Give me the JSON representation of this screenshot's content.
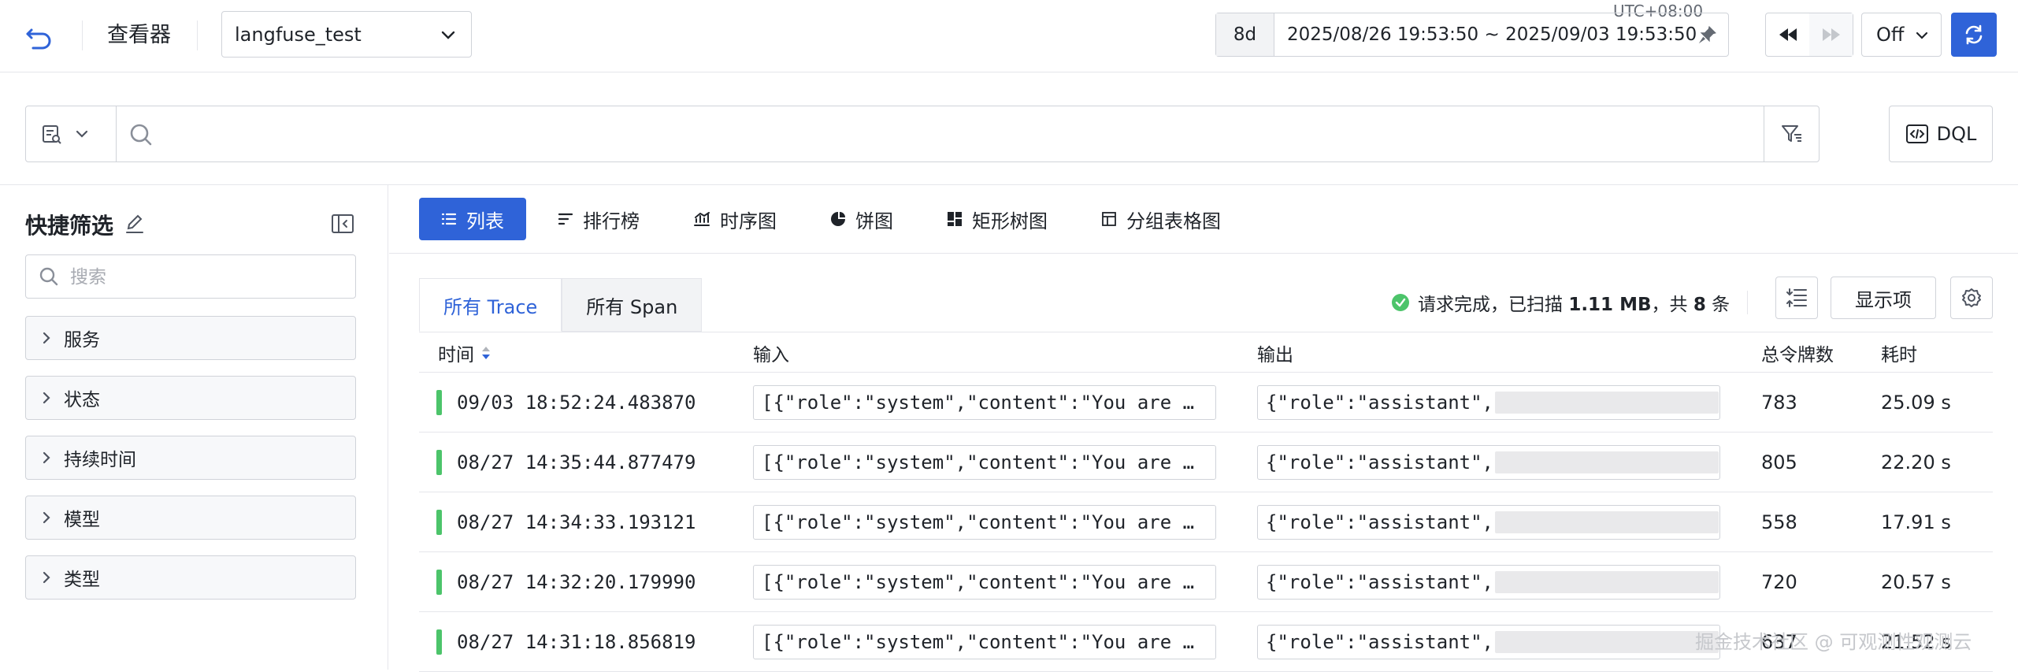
{
  "header": {
    "page_title": "查看器",
    "workspace": "langfuse_test",
    "timezone": "UTC+08:00",
    "time_range_short": "8d",
    "time_range": "2025/08/26 19:53:50 ~ 2025/09/03 19:53:50",
    "auto_refresh": "Off"
  },
  "search": {
    "placeholder": "",
    "dql_label": "DQL"
  },
  "quick_filter": {
    "title": "快捷筛选",
    "search_placeholder": "搜索",
    "groups": [
      "服务",
      "状态",
      "持续时间",
      "模型",
      "类型"
    ]
  },
  "view_tabs": [
    "列表",
    "排行榜",
    "时序图",
    "饼图",
    "矩形树图",
    "分组表格图"
  ],
  "sub_tabs": [
    "所有 Trace",
    "所有 Span"
  ],
  "status": {
    "prefix": "请求完成，已扫描 ",
    "size": "1.11 MB",
    "middle": "，共 ",
    "count": "8",
    "suffix": " 条"
  },
  "display_columns_label": "显示项",
  "table": {
    "columns": [
      "时间",
      "输入",
      "输出",
      "总令牌数",
      "耗时"
    ],
    "rows": [
      {
        "time": "09/03 18:52:24.483870",
        "input": "[{\"role\":\"system\",\"content\":\"You are …",
        "output": "{\"role\":\"assistant\",",
        "tokens": "783",
        "duration": "25.09 s"
      },
      {
        "time": "08/27 14:35:44.877479",
        "input": "[{\"role\":\"system\",\"content\":\"You are …",
        "output": "{\"role\":\"assistant\",",
        "tokens": "805",
        "duration": "22.20 s"
      },
      {
        "time": "08/27 14:34:33.193121",
        "input": "[{\"role\":\"system\",\"content\":\"You are …",
        "output": "{\"role\":\"assistant\",",
        "tokens": "558",
        "duration": "17.91 s"
      },
      {
        "time": "08/27 14:32:20.179990",
        "input": "[{\"role\":\"system\",\"content\":\"You are …",
        "output": "{\"role\":\"assistant\",",
        "tokens": "720",
        "duration": "20.57 s"
      },
      {
        "time": "08/27 14:31:18.856819",
        "input": "[{\"role\":\"system\",\"content\":\"You are …",
        "output": "{\"role\":\"assistant\",",
        "tokens": "637",
        "duration": "21.52 s"
      }
    ]
  },
  "watermark": "掘金技术社区 @ 可观测性观测云",
  "colors": {
    "accent": "#2f63d8",
    "status_ok": "#4cc46a",
    "border": "#d0d3d9"
  }
}
